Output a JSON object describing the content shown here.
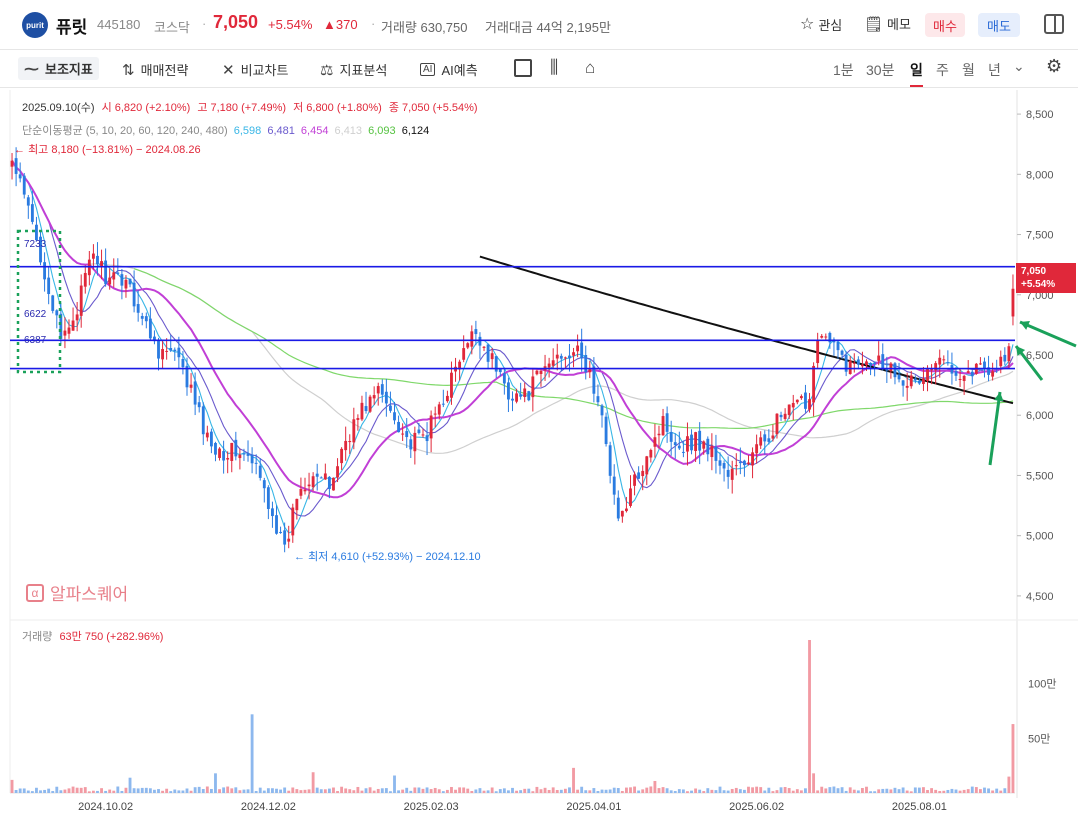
{
  "header": {
    "logo_text": "purit",
    "name": "퓨릿",
    "code": "445180",
    "market": "코스닥",
    "sep": "·",
    "price": "7,050",
    "change_pct": "+5.54%",
    "change_abs": "▲370",
    "volume": "거래량 630,750",
    "amount": "거래대금 44억 2,195만",
    "watch_label": "관심",
    "memo_label": "메모",
    "buy_label": "매수",
    "sell_label": "매도"
  },
  "toolbar": {
    "indicator_label": "보조지표",
    "strategy_label": "매매전략",
    "compare_label": "비교차트",
    "analysis_label": "지표분석",
    "ai_label": "AI예측",
    "periods": [
      "1분",
      "30분",
      "일",
      "주",
      "월",
      "년"
    ],
    "selected_period": "일"
  },
  "colors": {
    "up": "#e0283a",
    "down": "#2a7be0",
    "ma5": "#38b6e6",
    "ma10": "#6a5acd",
    "ma20": "#c13fd6",
    "ma60": "#cfcfcf",
    "ma120": "#7fd86a",
    "ma240": "#111111",
    "hline": "#1a1ae6",
    "arrow": "#1aa15a"
  },
  "chart_data": {
    "type": "candlestick",
    "info_line": {
      "date": "2025.09.10(수)",
      "open": "시 6,820 (+2.10%)",
      "high": "고 7,180 (+7.49%)",
      "low": "저 6,800 (+1.80%)",
      "close": "종 7,050 (+5.54%)"
    },
    "ma_legend": {
      "label": "단순이동평균 (5, 10, 20, 60, 120, 240, 480)",
      "values": [
        "6,598",
        "6,481",
        "6,454",
        "6,413",
        "6,093",
        "6,124"
      ]
    },
    "high_note": "최고 8,180 (−13.81%) − 2024.08.26",
    "low_note": "최저 4,610 (+52.93%) − 2024.12.10",
    "price_axis": {
      "min": 4300,
      "max": 8700,
      "ticks": [
        8500,
        8000,
        7500,
        7000,
        6500,
        6000,
        5500,
        5000,
        4500
      ],
      "tick_labels": [
        "8,500",
        "8,000",
        "7,500",
        "7,000",
        "6,500",
        "6,000",
        "5,500",
        "5,000",
        "4,500"
      ]
    },
    "x_ticks": [
      "2024.10.02",
      "2024.12.02",
      "2025.02.03",
      "2025.04.01",
      "2025.06.02",
      "2025.08.01"
    ],
    "x_tick_index": [
      23,
      63,
      103,
      143,
      183,
      223
    ],
    "horizontal_lines": [
      7233,
      6622,
      6387
    ],
    "box_labels": [
      "7233",
      "6622",
      "6387"
    ],
    "current_price_tag": {
      "price": "7,050",
      "pct": "+5.54%",
      "value": 7050
    },
    "watermark": "알파스퀘어",
    "volume_label": "거래량",
    "volume_value": "63만 750 (+282.96%)",
    "volume_axis": {
      "max": 1400000,
      "ticks": [
        1000000,
        500000
      ],
      "tick_labels": [
        "100만",
        "50만"
      ]
    },
    "close_anchors": [
      [
        0,
        8100
      ],
      [
        4,
        7700
      ],
      [
        8,
        7200
      ],
      [
        12,
        6600
      ],
      [
        16,
        6900
      ],
      [
        20,
        7350
      ],
      [
        24,
        7100
      ],
      [
        28,
        7150
      ],
      [
        32,
        6800
      ],
      [
        36,
        6550
      ],
      [
        40,
        6500
      ],
      [
        44,
        6200
      ],
      [
        48,
        5800
      ],
      [
        52,
        5700
      ],
      [
        56,
        5700
      ],
      [
        60,
        5550
      ],
      [
        64,
        5200
      ],
      [
        67,
        4850
      ],
      [
        70,
        5350
      ],
      [
        74,
        5550
      ],
      [
        78,
        5400
      ],
      [
        82,
        5800
      ],
      [
        86,
        6050
      ],
      [
        90,
        6200
      ],
      [
        94,
        6000
      ],
      [
        98,
        5750
      ],
      [
        102,
        5850
      ],
      [
        106,
        6150
      ],
      [
        110,
        6450
      ],
      [
        114,
        6700
      ],
      [
        118,
        6450
      ],
      [
        122,
        6200
      ],
      [
        126,
        6150
      ],
      [
        130,
        6350
      ],
      [
        134,
        6500
      ],
      [
        138,
        6550
      ],
      [
        142,
        6350
      ],
      [
        146,
        5800
      ],
      [
        149,
        5100
      ],
      [
        152,
        5350
      ],
      [
        156,
        5700
      ],
      [
        160,
        5950
      ],
      [
        164,
        5750
      ],
      [
        168,
        5800
      ],
      [
        172,
        5700
      ],
      [
        176,
        5500
      ],
      [
        180,
        5600
      ],
      [
        184,
        5750
      ],
      [
        188,
        5950
      ],
      [
        192,
        6050
      ],
      [
        196,
        6150
      ],
      [
        198,
        6700
      ],
      [
        202,
        6550
      ],
      [
        206,
        6400
      ],
      [
        210,
        6500
      ],
      [
        214,
        6450
      ],
      [
        218,
        6350
      ],
      [
        222,
        6250
      ],
      [
        226,
        6400
      ],
      [
        230,
        6450
      ],
      [
        234,
        6350
      ],
      [
        238,
        6400
      ],
      [
        242,
        6400
      ],
      [
        245,
        6550
      ],
      [
        246,
        7050
      ]
    ],
    "volume_spikes": [
      [
        0,
        120000
      ],
      [
        29,
        140000
      ],
      [
        50,
        180000
      ],
      [
        59,
        720000
      ],
      [
        74,
        190000
      ],
      [
        94,
        160000
      ],
      [
        138,
        230000
      ],
      [
        158,
        110000
      ],
      [
        196,
        1400000
      ],
      [
        197,
        180000
      ],
      [
        246,
        630750
      ],
      [
        245,
        150000
      ]
    ]
  }
}
